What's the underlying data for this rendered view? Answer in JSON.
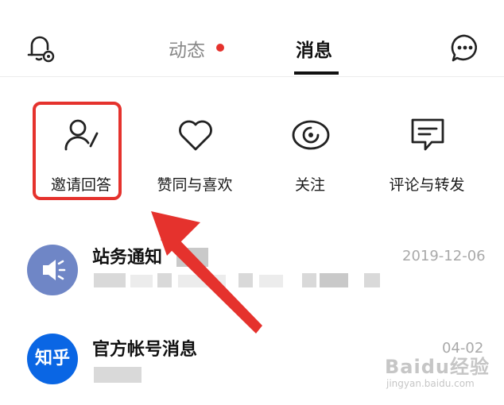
{
  "header": {
    "tabs": [
      {
        "label": "动态",
        "has_dot": true
      },
      {
        "label": "消息",
        "active": true
      }
    ],
    "left_icon": "bell-settings-icon",
    "right_icon": "chat-bubble-icon",
    "dot_color": "#e5322d"
  },
  "categories": [
    {
      "label": "邀请回答",
      "icon": "user-pen-icon",
      "highlighted": true
    },
    {
      "label": "赞同与喜欢",
      "icon": "heart-icon"
    },
    {
      "label": "关注",
      "icon": "eye-icon"
    },
    {
      "label": "评论与转发",
      "icon": "comment-icon"
    }
  ],
  "messages": [
    {
      "title": "站务通知",
      "time": "2019-12-06",
      "avatar_icon": "speaker-icon",
      "avatar_color": "#6f86c6"
    },
    {
      "title": "官方帐号消息",
      "time": "04-02",
      "avatar_text": "知乎",
      "avatar_color": "#0a66e4"
    }
  ],
  "watermark": {
    "logo": "Baidu经验",
    "url": "jingyan.baidu.com"
  },
  "accent_color": "#e5322d"
}
